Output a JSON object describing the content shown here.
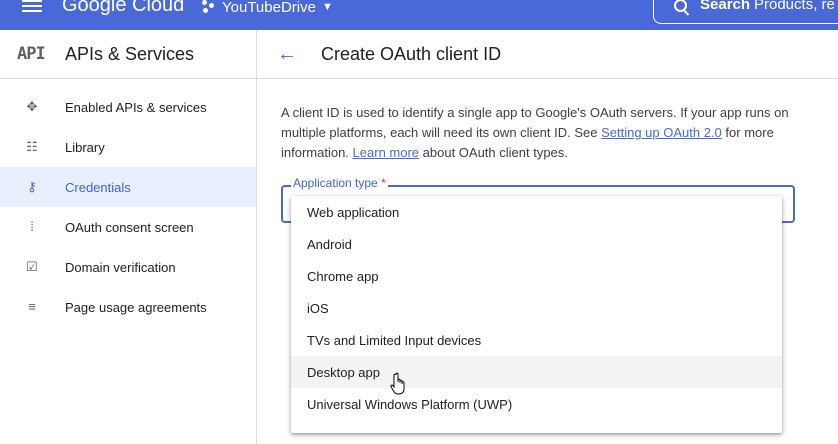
{
  "topbar": {
    "logo": "Google Cloud",
    "project": "YouTubeDrive",
    "search_label": "Search",
    "search_placeholder": "Products, re"
  },
  "sidebar": {
    "badge": "API",
    "title": "APIs & Services",
    "items": [
      {
        "label": "Enabled APIs & services",
        "icon": "enabled-apis-icon"
      },
      {
        "label": "Library",
        "icon": "library-icon"
      },
      {
        "label": "Credentials",
        "icon": "key-icon",
        "active": true
      },
      {
        "label": "OAuth consent screen",
        "icon": "consent-icon"
      },
      {
        "label": "Domain verification",
        "icon": "checkbox-icon"
      },
      {
        "label": "Page usage agreements",
        "icon": "settings-list-icon"
      }
    ]
  },
  "main": {
    "title": "Create OAuth client ID",
    "desc_1": "A client ID is used to identify a single app to Google's OAuth servers. If your app runs on multiple platforms, each will need its own client ID. See ",
    "desc_link_1": "Setting up OAuth 2.0",
    "desc_2": " for more information. ",
    "desc_link_2": "Learn more",
    "desc_3": " about OAuth client types.",
    "field_label": "Application type",
    "required_mark": "*"
  },
  "dropdown": {
    "options": [
      "Web application",
      "Android",
      "Chrome app",
      "iOS",
      "TVs and Limited Input devices",
      "Desktop app",
      "Universal Windows Platform (UWP)"
    ],
    "hovered": "Desktop app"
  },
  "colors": {
    "accent": "#4a69d9",
    "active_bg": "#e8f0fe",
    "required": "#d93025"
  }
}
